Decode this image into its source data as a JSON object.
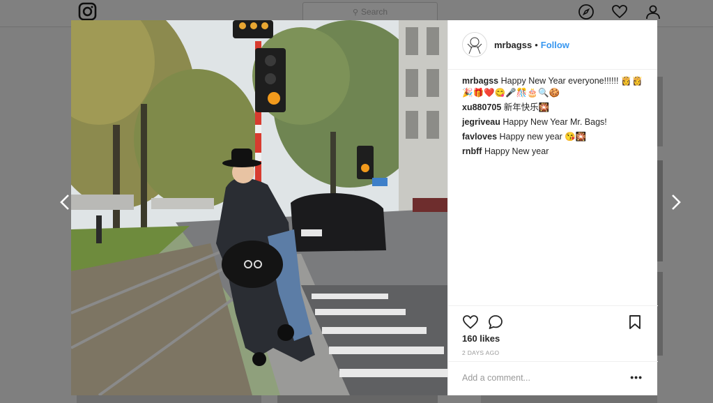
{
  "topbar": {
    "logo_icon": "instagram-icon",
    "search_placeholder": "Search",
    "icons": [
      "compass-icon",
      "heart-icon",
      "person-icon"
    ]
  },
  "post": {
    "username": "mrbagss",
    "follow_label": "Follow",
    "separator": "•",
    "comments": [
      {
        "user": "mrbagss",
        "text": "Happy New Year everyone!!!!!! 👸👸 🎉🎁❤️😋🎤🎊🎂🔍🍪"
      },
      {
        "user": "xu880705",
        "text": "新年快乐🎇"
      },
      {
        "user": "jegriveau",
        "text": "Happy New Year Mr. Bags!"
      },
      {
        "user": "favloves",
        "text": "Happy new year 😘🎇"
      },
      {
        "user": "rnbff",
        "text": "Happy New year"
      }
    ],
    "likes": "160 likes",
    "date": "2 DAYS AGO",
    "add_comment_placeholder": "Add a comment...",
    "more_label": "•••"
  },
  "colors": {
    "accent": "#3897f0",
    "overlay": "#7f7f7f"
  }
}
